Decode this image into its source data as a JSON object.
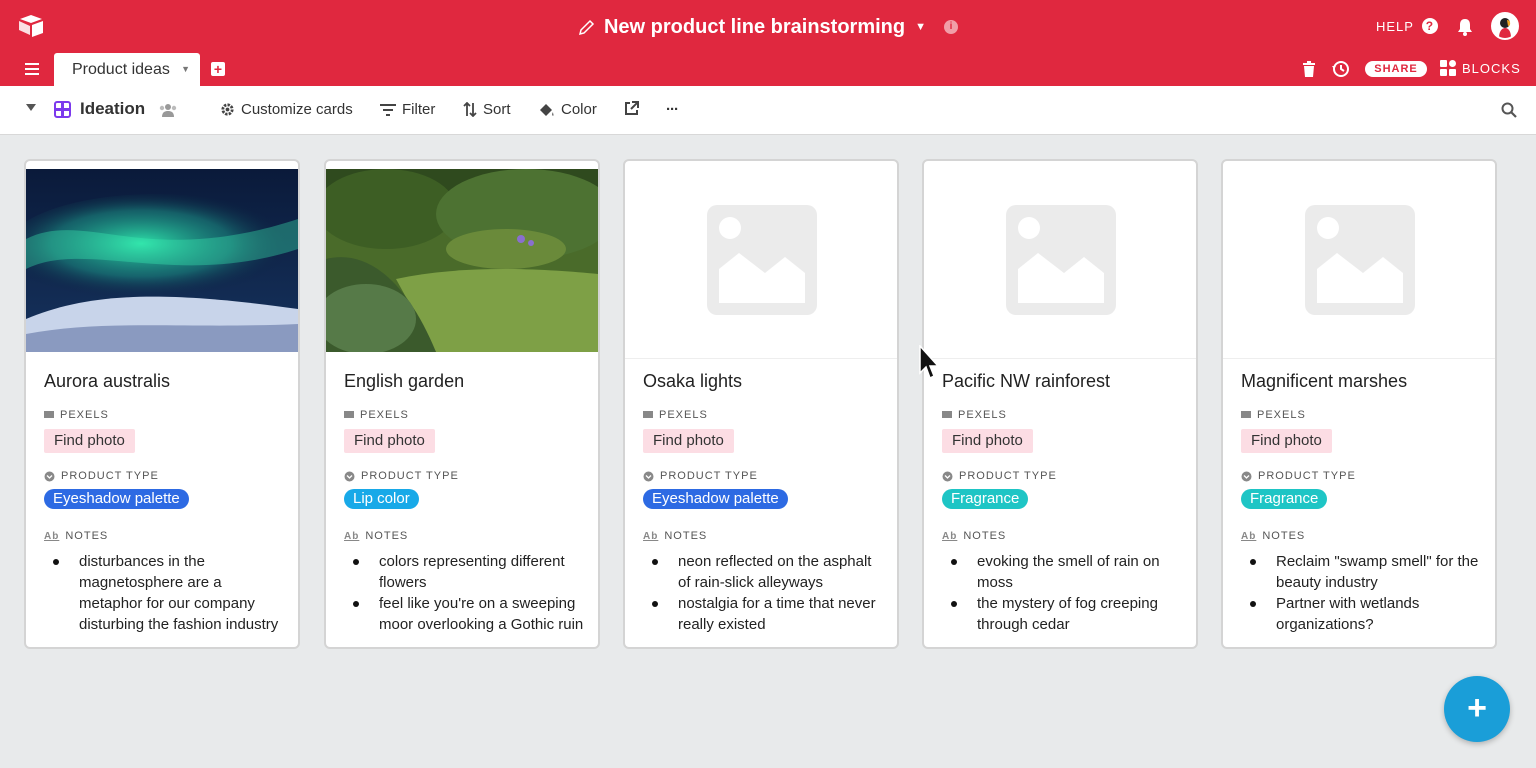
{
  "header": {
    "base_title": "New product line brainstorming",
    "help_label": "HELP",
    "share_label": "SHARE",
    "blocks_label": "BLOCKS",
    "bg_color": "#e0283f"
  },
  "tabs": [
    {
      "label": "Product ideas",
      "active": true
    }
  ],
  "viewbar": {
    "view_name": "Ideation",
    "customize_label": "Customize cards",
    "filter_label": "Filter",
    "sort_label": "Sort",
    "color_label": "Color",
    "more_label": "···"
  },
  "field_labels": {
    "pexels": "PEXELS",
    "product_type": "PRODUCT TYPE",
    "notes": "NOTES"
  },
  "cards": [
    {
      "title": "Aurora australis",
      "pexels": "Find photo",
      "product_type": "Eyeshadow palette",
      "type_color": "#2d6ae3",
      "image": "aurora",
      "notes": [
        "disturbances in the magnetosphere are a metaphor for our company disturbing the fashion industry"
      ]
    },
    {
      "title": "English garden",
      "pexels": "Find photo",
      "product_type": "Lip color",
      "type_color": "#18a9e8",
      "image": "garden",
      "notes": [
        "colors representing different flowers",
        "feel like you're on a sweeping moor overlooking a Gothic ruin"
      ]
    },
    {
      "title": "Osaka lights",
      "pexels": "Find photo",
      "product_type": "Eyeshadow palette",
      "type_color": "#2d6ae3",
      "image": "placeholder",
      "notes": [
        "neon reflected on the asphalt of rain-slick alleyways",
        "nostalgia for a time that never really existed"
      ]
    },
    {
      "title": "Pacific NW rainforest",
      "pexels": "Find photo",
      "product_type": "Fragrance",
      "type_color": "#1ec5c5",
      "image": "placeholder",
      "notes": [
        "evoking the smell of rain on moss",
        "the mystery of fog creeping through cedar"
      ]
    },
    {
      "title": "Magnificent marshes",
      "pexels": "Find photo",
      "product_type": "Fragrance",
      "type_color": "#1ec5c5",
      "image": "placeholder",
      "notes": [
        "Reclaim \"swamp smell\" for the beauty industry",
        "Partner with wetlands organizations?"
      ]
    }
  ],
  "fab_label": "+"
}
